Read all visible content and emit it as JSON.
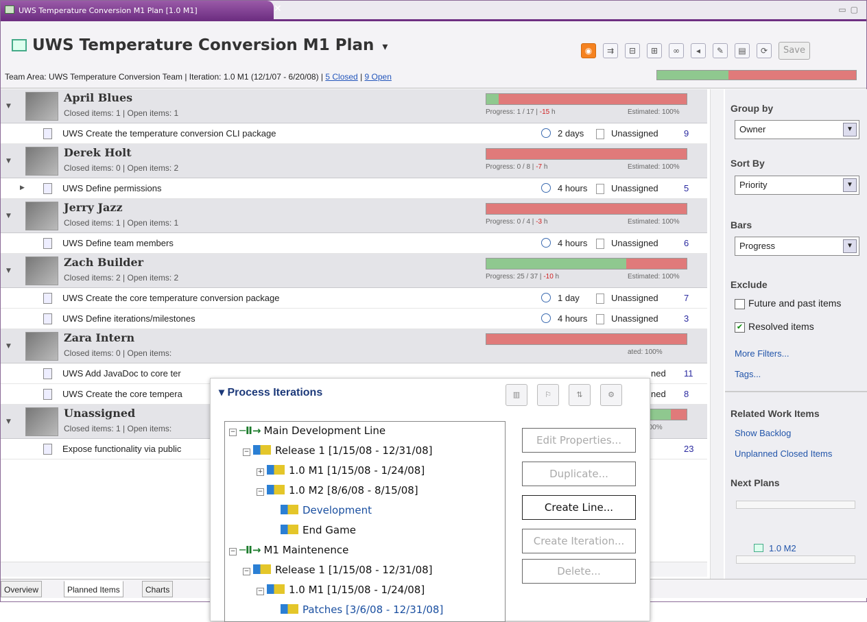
{
  "tab": {
    "label": "UWS Temperature Conversion M1 Plan [1.0 M1]",
    "close": "✕"
  },
  "header": {
    "title": "UWS Temperature Conversion M1 Plan",
    "title_menu": "▾",
    "team_text": "Team Area: UWS Temperature Conversion Team | Iteration: 1.0 M1 (12/1/07 - 6/20/08) | ",
    "closed_link": "5 Closed",
    "sep": " | ",
    "open_link": "9 Open",
    "save_label": "Save",
    "overall_progress": 0.36
  },
  "owners": [
    {
      "name": "April Blues",
      "counts": "Closed items: 1 | Open items: 1",
      "progress_frac": 0.06,
      "prog_a": "Progress: 1 / 17 | ",
      "prog_neg": "-15",
      "prog_b": " h",
      "est": "Estimated: 100%",
      "items": [
        {
          "text": "UWS Create the temperature conversion CLI package",
          "dur": "2 days",
          "assignee": "Unassigned",
          "num": "9",
          "expand": ""
        }
      ]
    },
    {
      "name": "Derek Holt",
      "counts": "Closed items: 0 | Open items: 2",
      "progress_frac": 0.0,
      "prog_a": "Progress: 0 / 8 | ",
      "prog_neg": "-7",
      "prog_b": " h",
      "est": "Estimated: 100%",
      "items": [
        {
          "text": "UWS Define permissions",
          "dur": "4 hours",
          "assignee": "Unassigned",
          "num": "5",
          "expand": "▶"
        }
      ]
    },
    {
      "name": "Jerry Jazz",
      "counts": "Closed items: 1 | Open items: 1",
      "progress_frac": 0.0,
      "prog_a": "Progress: 0 / 4 | ",
      "prog_neg": "-3",
      "prog_b": " h",
      "est": "Estimated: 100%",
      "items": [
        {
          "text": "UWS Define team members",
          "dur": "4 hours",
          "assignee": "Unassigned",
          "num": "6",
          "expand": ""
        }
      ]
    },
    {
      "name": "Zach Builder",
      "counts": "Closed items: 2 | Open items: 2",
      "progress_frac": 0.7,
      "prog_a": "Progress: 25 / 37 | ",
      "prog_neg": "-10",
      "prog_b": " h",
      "est": "Estimated: 100%",
      "items": [
        {
          "text": "UWS Create the core temperature conversion package",
          "dur": "1 day",
          "assignee": "Unassigned",
          "num": "7",
          "expand": ""
        },
        {
          "text": "UWS Define iterations/milestones",
          "dur": "4 hours",
          "assignee": "Unassigned",
          "num": "3",
          "expand": ""
        }
      ]
    },
    {
      "name": "Zara Intern",
      "counts": "Closed items: 0 | Open items:",
      "progress_frac": 0.0,
      "prog_a": "",
      "prog_neg": "",
      "prog_b": "",
      "est": "ated: 100%",
      "items": [
        {
          "text": "UWS Add JavaDoc to core ter",
          "dur": "",
          "assignee": "ned",
          "num": "11",
          "expand": ""
        },
        {
          "text": "UWS Create the core tempera",
          "dur": "",
          "assignee": "ned",
          "num": "8",
          "expand": ""
        }
      ]
    },
    {
      "name": "Unassigned",
      "counts": "Closed items: 1 | Open items:",
      "progress_frac": 0.92,
      "prog_a": "",
      "prog_neg": "",
      "prog_b": "",
      "est": "ated: 100%",
      "items": [
        {
          "text": "Expose functionality via public",
          "dur": "",
          "assignee": "",
          "num": "23",
          "expand": ""
        }
      ]
    }
  ],
  "right": {
    "group_by_label": "Group by",
    "group_by_value": "Owner",
    "sort_by_label": "Sort By",
    "sort_by_value": "Priority",
    "bars_label": "Bars",
    "bars_value": "Progress",
    "exclude_label": "Exclude",
    "future_label": "Future and past items",
    "future_checked": false,
    "resolved_label": "Resolved items",
    "resolved_checked": true,
    "more_filters": "More Filters...",
    "tags": "Tags...",
    "related_label": "Related Work Items",
    "show_backlog": "Show Backlog",
    "unplanned": "Unplanned Closed Items",
    "next_plans_label": "Next Plans",
    "next_plan": "1.0 M2"
  },
  "bottom_tabs": [
    "Overview",
    "Planned Items",
    "Charts"
  ],
  "popup": {
    "title": "Process Iterations",
    "tree": [
      {
        "label": "Main Development Line",
        "kind": "line",
        "pm": "−",
        "blue": false
      },
      {
        "label": "Release 1 [1/15/08 - 12/31/08]",
        "kind": "flag",
        "pm": "−",
        "blue": false
      },
      {
        "label": "1.0 M1 [1/15/08 - 1/24/08]",
        "kind": "flag",
        "pm": "+",
        "blue": false
      },
      {
        "label": "1.0 M2 [8/6/08 - 8/15/08]",
        "kind": "flag",
        "pm": "−",
        "blue": false
      },
      {
        "label": "Development",
        "kind": "flag",
        "pm": "",
        "blue": true
      },
      {
        "label": "End Game",
        "kind": "flag",
        "pm": "",
        "blue": false
      },
      {
        "label": "M1 Maintenence",
        "kind": "line",
        "pm": "−",
        "blue": false
      },
      {
        "label": "Release 1 [1/15/08 - 12/31/08]",
        "kind": "flag",
        "pm": "−",
        "blue": false
      },
      {
        "label": "1.0 M1 [1/15/08 - 1/24/08]",
        "kind": "flag",
        "pm": "−",
        "blue": false
      },
      {
        "label": "Patches [3/6/08 - 12/31/08]",
        "kind": "flag",
        "pm": "",
        "blue": true
      }
    ],
    "buttons": [
      {
        "label": "Edit Properties...",
        "enabled": false
      },
      {
        "label": "Duplicate...",
        "enabled": false
      },
      {
        "label": "Create Line...",
        "enabled": true
      },
      {
        "label": "Create Iteration...",
        "enabled": false
      },
      {
        "label": "Delete...",
        "enabled": false
      }
    ]
  }
}
